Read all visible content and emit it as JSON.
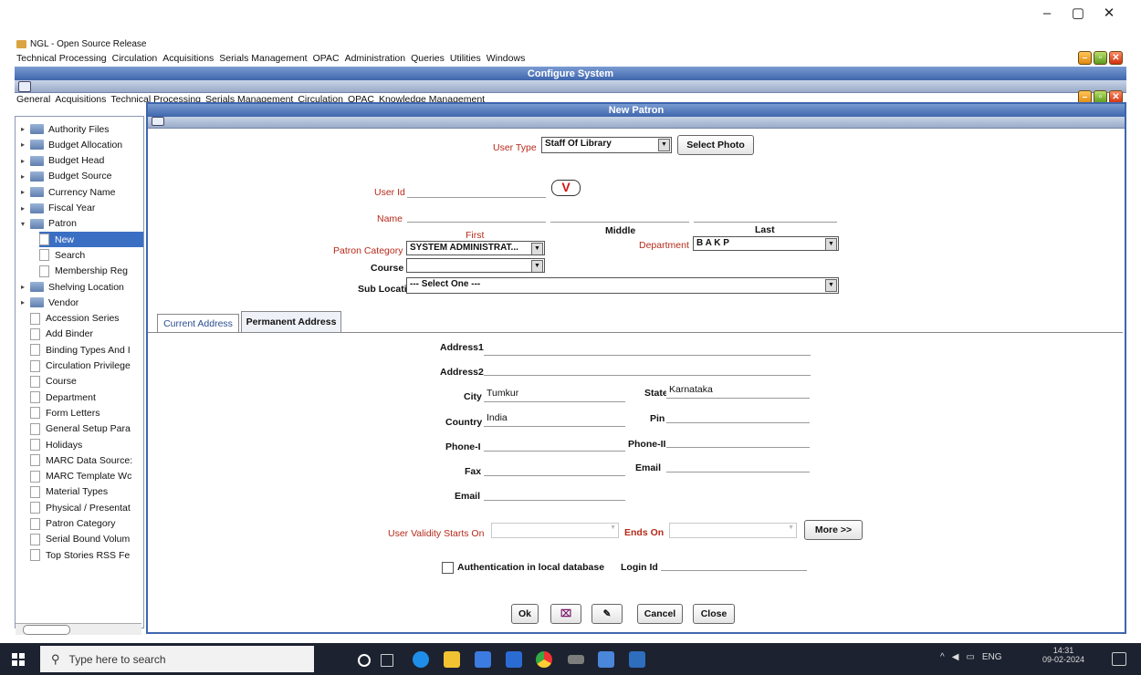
{
  "window_controls": {
    "minimize": "–",
    "maximize": "▢",
    "close": "✕"
  },
  "app": {
    "title": "NGL - Open Source Release"
  },
  "menu": [
    "Technical Processing",
    "Circulation",
    "Acquisitions",
    "Serials Management",
    "OPAC",
    "Administration",
    "Queries",
    "Utilities",
    "Windows"
  ],
  "configure_window": {
    "title": "Configure System",
    "tabs": [
      "General",
      "Acquisitions",
      "Technical Processing",
      "Serials Management",
      "Circulation",
      "OPAC",
      "Knowledge Management"
    ]
  },
  "tree": {
    "folders_top": [
      "Authority Files",
      "Budget Allocation",
      "Budget Head",
      "Budget Source",
      "Currency Name",
      "Fiscal Year",
      "Patron"
    ],
    "patron_children": [
      "New",
      "Search",
      "Membership Reg"
    ],
    "folders_bottom": [
      "Shelving Location",
      "Vendor"
    ],
    "docs": [
      "Accession Series",
      "Add Binder",
      "Binding Types And I",
      "Circulation Privilege",
      "Course",
      "Department",
      "Form Letters",
      "General Setup Para",
      "Holidays",
      "MARC Data Source:",
      "MARC Template Wc",
      "Material Types",
      "Physical / Presentat",
      "Patron Category",
      "Serial Bound Volum",
      "Top Stories RSS Fe"
    ]
  },
  "form": {
    "title": "New Patron",
    "user_type_label": "User Type",
    "user_type_value": "Staff Of Library",
    "select_photo": "Select Photo",
    "user_id_label": "User Id",
    "name_label": "Name",
    "first": "First",
    "middle": "Middle",
    "last": "Last",
    "patron_category_label": "Patron Category",
    "patron_category_value": "SYSTEM ADMINISTRAT...",
    "department_label": "Department",
    "department_value": "B A  K P",
    "course_label": "Course",
    "course_value": "",
    "sub_location_label": "Sub Location",
    "sub_location_value": "--- Select One ---",
    "tabs": [
      "Current Address",
      "Permanent Address"
    ],
    "address1": "Address1",
    "address2": "Address2",
    "city_label": "City",
    "city_value": "Tumkur",
    "state_label": "State",
    "state_value": "Karnataka",
    "country_label": "Country",
    "country_value": "India",
    "pin_label": "Pin",
    "phone1": "Phone-I",
    "phone2": "Phone-II",
    "fax": "Fax",
    "email_right": "Email",
    "email_left": "Email",
    "validity_label": "User Validity Starts On",
    "ends_label": "Ends On",
    "more": "More >>",
    "auth_label": "Authentication in local database",
    "login_label": "Login Id",
    "ok": "Ok",
    "cancel": "Cancel",
    "close": "Close"
  },
  "taskbar": {
    "search_placeholder": "Type here to search",
    "lang": "ENG",
    "time": "14:31",
    "date": "09-02-2024"
  }
}
